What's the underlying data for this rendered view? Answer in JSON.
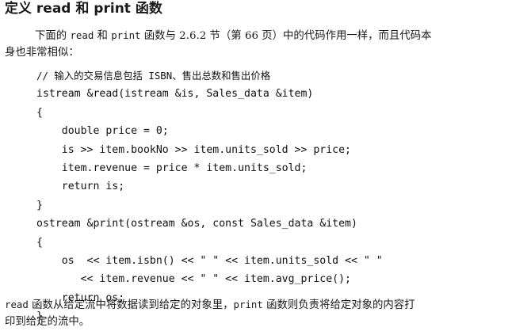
{
  "heading": "定义 read 和 print 函数",
  "para1": {
    "t1": "下面的 ",
    "c1": "read",
    "t2": " 和 ",
    "c2": "print",
    "t3": " 函数与 2.6.2 节（第 66 页）中的代码作用一样，而且代码本",
    "t4": "身也非常相似："
  },
  "code_lines": [
    "// 输入的交易信息包括 ISBN、售出总数和售出价格",
    "istream &read(istream &is, Sales_data &item)",
    "{",
    "    double price = 0;",
    "    is >> item.bookNo >> item.units_sold >> price;",
    "    item.revenue = price * item.units_sold;",
    "    return is;",
    "}",
    "ostream &print(ostream &os, const Sales_data &item)",
    "{",
    "    os  << item.isbn() << \" \" << item.units_sold << \" \"",
    "       << item.revenue << \" \" << item.avg_price();",
    "    return os;",
    "}"
  ],
  "para2": {
    "c1": "read",
    "t1": " 函数从给定流中将数据读到给定的对象里，",
    "c2": "print",
    "t2": " 函数则负责将给定对象的内容打",
    "t3": "印到给定的流中。"
  }
}
